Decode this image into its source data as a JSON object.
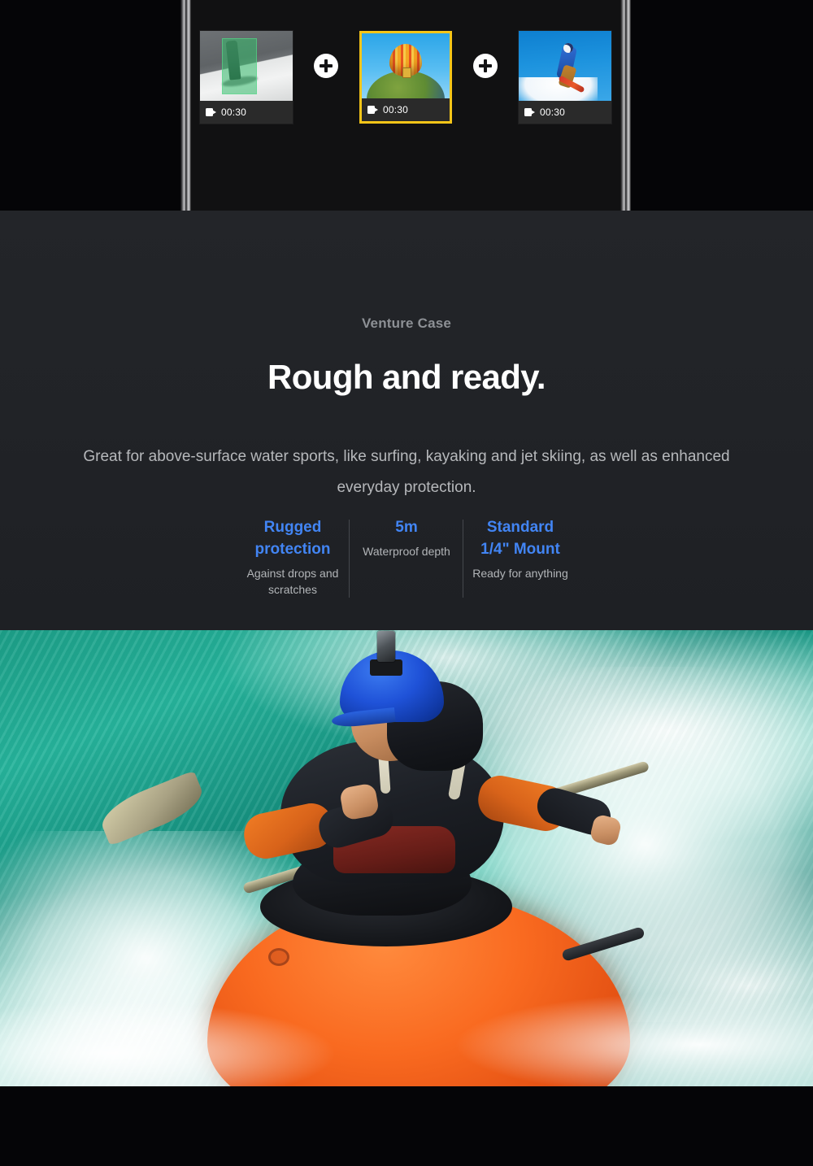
{
  "editor": {
    "clips": [
      {
        "name": "clip-1",
        "duration": "00:30",
        "icon": "video-camera-icon",
        "selected": false,
        "scene": "snowboarder-grayscale-with-green-selection"
      },
      {
        "name": "clip-2",
        "duration": "00:30",
        "icon": "video-camera-icon",
        "selected": true,
        "scene": "hot-air-balloon-over-globe"
      },
      {
        "name": "clip-3",
        "duration": "00:30",
        "icon": "video-camera-icon",
        "selected": false,
        "scene": "snowboarder-jumping-blue-sky"
      }
    ],
    "add_buttons": [
      {
        "name": "add-clip-1",
        "label": "+"
      },
      {
        "name": "add-clip-2",
        "label": "+"
      }
    ],
    "selection_color": "#f5c518"
  },
  "product": {
    "eyebrow": "Venture Case",
    "headline": "Rough and ready.",
    "description": "Great for above-surface water sports, like surfing, kayaking and jet skiing, as well as enhanced everyday protection.",
    "accent_color": "#4285f4",
    "specs": [
      {
        "title": "Rugged protection",
        "sub": "Against drops and scratches"
      },
      {
        "title": "5m",
        "sub": "Waterproof depth"
      },
      {
        "title": "Standard 1/4\" Mount",
        "sub": "Ready for anything"
      }
    ]
  },
  "hero": {
    "alt": "Kayaker in whitewater wearing a blue helmet with a mounted action camera",
    "water_color": "#1d9f88",
    "kayak_color": "#f96a20",
    "helmet_color": "#1f52d8"
  }
}
